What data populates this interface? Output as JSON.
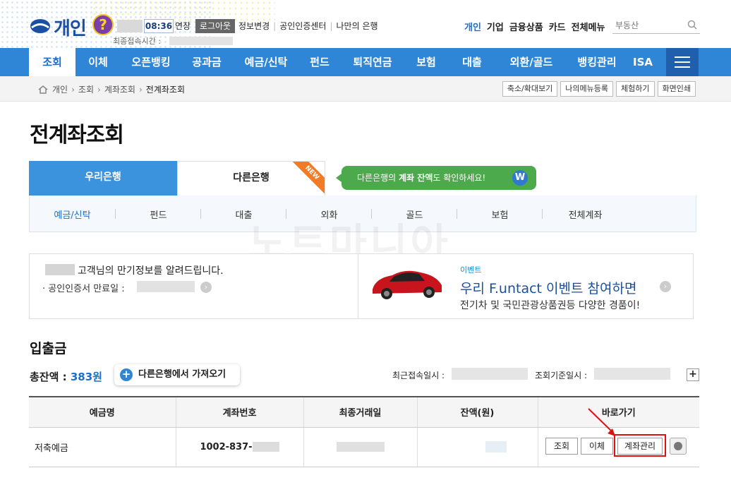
{
  "header": {
    "logo": "개인",
    "help": "?",
    "timer": "08:36",
    "extend": "연장",
    "logout": "로그아웃",
    "util_links": [
      "정보변경",
      "공인인증센터",
      "나만의 은행"
    ],
    "last_login_label": "최종접속시간 :",
    "top_nav": [
      "개인",
      "기업",
      "금융상품",
      "카드",
      "전체메뉴"
    ],
    "top_nav_active": "개인",
    "search_placeholder": "부동산"
  },
  "main_nav": [
    "조회",
    "이체",
    "오픈뱅킹",
    "공과금",
    "예금/신탁",
    "펀드",
    "퇴직연금",
    "보험",
    "대출",
    "외환/골드",
    "뱅킹관리",
    "ISA"
  ],
  "main_nav_active": "조회",
  "breadcrumb": [
    "개인",
    "조회",
    "계좌조회",
    "전계좌조회"
  ],
  "crumb_buttons": [
    "축소/확대보기",
    "나의메뉴등록",
    "체험하기",
    "화면인쇄"
  ],
  "page_title": "전계좌조회",
  "bank_tabs": {
    "active": "우리은행",
    "other": "다른은행",
    "new_badge": "NEW"
  },
  "promo": {
    "prefix": "다른은행의 ",
    "bold": "계좌 잔액",
    "suffix": "도 확인하세요!",
    "icon": "W"
  },
  "sub_tabs": [
    "예금/신탁",
    "펀드",
    "대출",
    "외화",
    "골드",
    "보험",
    "전체계좌"
  ],
  "sub_tab_active": "예금/신탁",
  "watermark": "노트마니아",
  "maturity": {
    "message": "고객님의 만기정보를 알려드립니다.",
    "cert_label": "· 공인인증서 만료일 :"
  },
  "event": {
    "tag": "이벤트",
    "title": "우리 F.untact 이벤트 참여하면",
    "desc": "전기차 및 국민관광상품권등 다양한 경품이!"
  },
  "deposits": {
    "section_title": "입출금",
    "total_label": "총잔액 :",
    "total_value": "383원",
    "fetch_button": "다른은행에서 가져오기",
    "recent_login_label": "최근접속일시 :",
    "query_date_label": "조회기준일시 :",
    "expand": "+",
    "columns": [
      "예금명",
      "계좌번호",
      "최종거래일",
      "잔액(원)",
      "바로가기"
    ],
    "rows": [
      {
        "name": "저축예금",
        "account_prefix": "1002-837-",
        "actions": [
          "조회",
          "이체",
          "계좌관리"
        ]
      }
    ]
  },
  "colors": {
    "primary_blue": "#2f86d6",
    "highlight_red": "#e01010",
    "promo_green": "#4caa4c",
    "new_orange": "#f07c28"
  }
}
